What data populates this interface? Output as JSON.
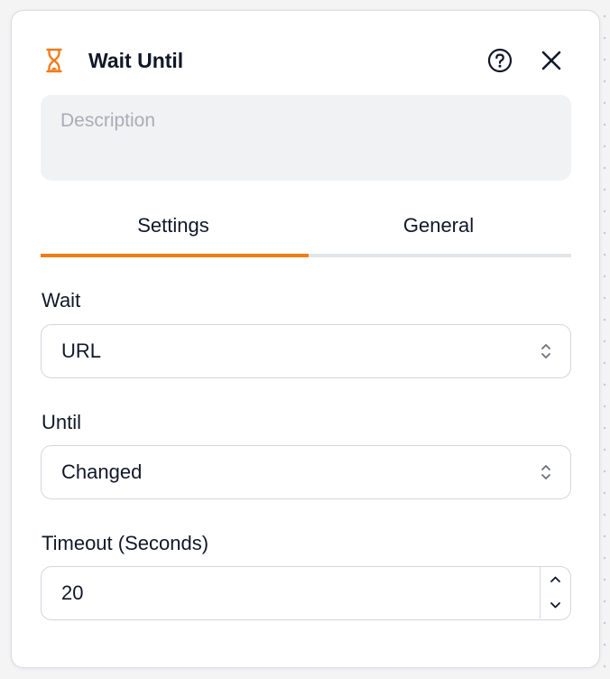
{
  "panel": {
    "title": "Wait Until",
    "icons": {
      "node": "hourglass-icon",
      "help": "question-circle-icon",
      "close": "close-icon"
    },
    "accent_color": "#f07c1a"
  },
  "description": {
    "placeholder": "Description",
    "value": ""
  },
  "tabs": [
    {
      "label": "Settings",
      "active": true
    },
    {
      "label": "General",
      "active": false
    }
  ],
  "fields": {
    "wait": {
      "label": "Wait",
      "value": "URL"
    },
    "until": {
      "label": "Until",
      "value": "Changed"
    },
    "timeout": {
      "label": "Timeout (Seconds)",
      "value": "20"
    }
  }
}
